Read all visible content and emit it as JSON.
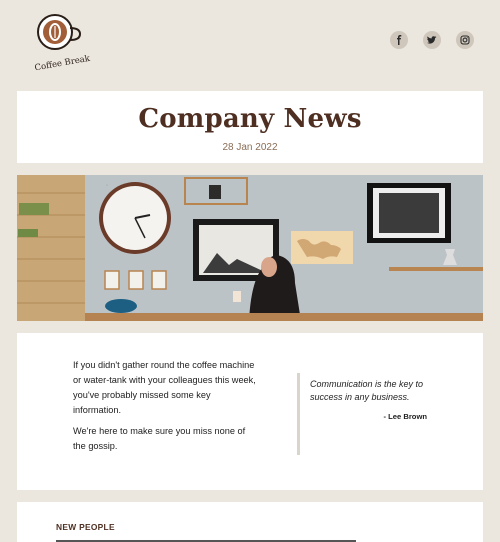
{
  "brand": {
    "logo_text": "Coffee Break",
    "icons": [
      "coffee-cup-icon"
    ]
  },
  "social": {
    "items": [
      {
        "name": "facebook-icon",
        "glyph": "f"
      },
      {
        "name": "twitter-icon",
        "glyph": "🐦"
      },
      {
        "name": "instagram-icon",
        "glyph": "◎"
      }
    ]
  },
  "header": {
    "title": "Company News",
    "date": "28 Jan 2022"
  },
  "intro": {
    "paragraph1": "If you didn't gather round the coffee machine or water-tank with your colleagues this week, you've probably missed some key information.",
    "paragraph2": "We're here to make sure you miss none of the gossip."
  },
  "quote": {
    "text": "Communication is the key to success in any business.",
    "author": "- Lee Brown"
  },
  "sections": {
    "new_people": "NEW PEOPLE"
  },
  "colors": {
    "background": "#ebe6de",
    "accent": "#4e2f22",
    "date": "#8a6d55"
  }
}
